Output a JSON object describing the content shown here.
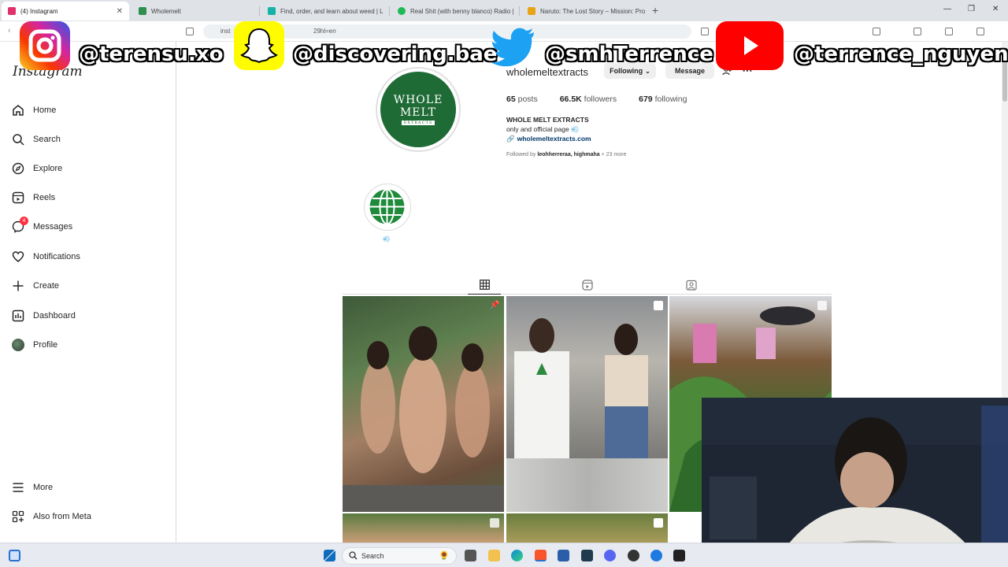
{
  "browser": {
    "tabs": [
      {
        "title": "(4) Instagram",
        "color": "#e1306c",
        "active": true
      },
      {
        "title": "Wholemelt",
        "color": "#2f8f4e"
      },
      {
        "title": "Find, order, and learn about weed | L",
        "color": "#17b3a6"
      },
      {
        "title": "Real Shit (with benny blanco) Radio |",
        "color": "#1db954"
      },
      {
        "title": "Naruto: The Lost Story – Mission: Pro",
        "color": "#e8a317"
      }
    ],
    "new_tab": "+",
    "url": "inst",
    "url_tail": "29hl=en"
  },
  "overlay": {
    "instagram": "@terensu.xo",
    "snapchat": "@discovering.bae",
    "twitter": "@smhTerrence",
    "youtube": "@terrence_nguyen"
  },
  "sidebar": {
    "logo": "Instagram",
    "items": [
      {
        "label": "Home",
        "icon": "home-icon"
      },
      {
        "label": "Search",
        "icon": "search-icon"
      },
      {
        "label": "Explore",
        "icon": "compass-icon"
      },
      {
        "label": "Reels",
        "icon": "reels-icon"
      },
      {
        "label": "Messages",
        "icon": "messenger-icon",
        "badge": "4"
      },
      {
        "label": "Notifications",
        "icon": "heart-icon"
      },
      {
        "label": "Create",
        "icon": "plus-icon"
      },
      {
        "label": "Dashboard",
        "icon": "dashboard-icon"
      },
      {
        "label": "Profile",
        "icon": "profile-avatar-icon"
      }
    ],
    "bottom": [
      {
        "label": "More",
        "icon": "menu-icon"
      },
      {
        "label": "Also from Meta",
        "icon": "meta-icon"
      }
    ]
  },
  "profile": {
    "avatar_text": [
      "WHOLE",
      "MELT",
      "EXTRACTS"
    ],
    "username": "wholemeltextracts",
    "following_btn": "Following",
    "message_btn": "Message",
    "stats": {
      "posts": "65",
      "posts_label": "posts",
      "followers": "66.5K",
      "followers_label": "followers",
      "following": "679",
      "following_label": "following"
    },
    "bio_name": "WHOLE MELT EXTRACTS",
    "bio_line": "only and official page 💨",
    "bio_link": "wholemeltextracts.com",
    "followed_by_prefix": "Followed by",
    "followed_by_users": "leohherreraa, highmaha",
    "followed_by_more": "+ 23 more",
    "highlight_label": "💨"
  },
  "colors": {
    "brand_green": "#1f6b35",
    "link_blue": "#00376b",
    "badge_red": "#ff3040"
  },
  "taskbar": {
    "search_label": "Search"
  }
}
